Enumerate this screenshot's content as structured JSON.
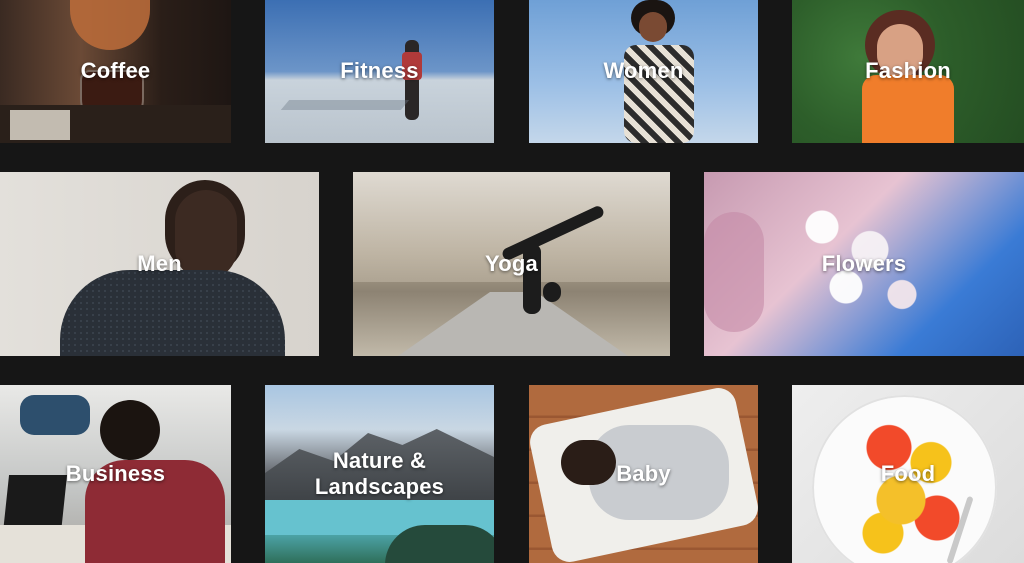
{
  "categories": [
    {
      "id": "coffee",
      "label": "Coffee"
    },
    {
      "id": "fitness",
      "label": "Fitness"
    },
    {
      "id": "women",
      "label": "Women"
    },
    {
      "id": "fashion",
      "label": "Fashion"
    },
    {
      "id": "men",
      "label": "Men"
    },
    {
      "id": "yoga",
      "label": "Yoga"
    },
    {
      "id": "flowers",
      "label": "Flowers"
    },
    {
      "id": "business",
      "label": "Business"
    },
    {
      "id": "nature",
      "label": "Nature &\nLandscapes"
    },
    {
      "id": "baby",
      "label": "Baby"
    },
    {
      "id": "food",
      "label": "Food"
    }
  ]
}
